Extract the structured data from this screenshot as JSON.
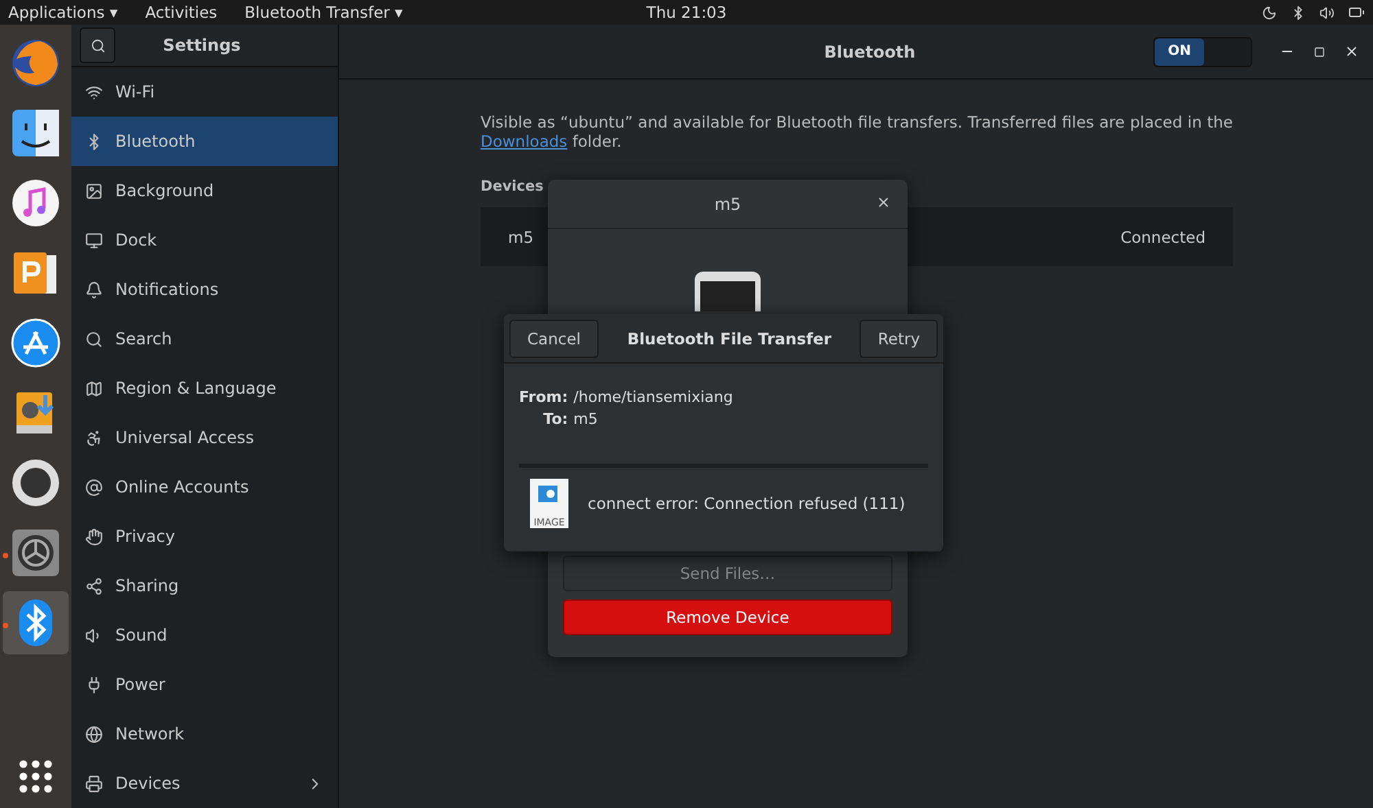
{
  "top_bar": {
    "applications": "Applications ▾",
    "activities": "Activities",
    "app_menu": "Bluetooth Transfer ▾",
    "clock": "Thu 21:03"
  },
  "dock": [
    {
      "running": false,
      "selected": false
    },
    {
      "running": false,
      "selected": false
    },
    {
      "running": false,
      "selected": false
    },
    {
      "running": false,
      "selected": false
    },
    {
      "running": false,
      "selected": false
    },
    {
      "running": false,
      "selected": false
    },
    {
      "running": false,
      "selected": false
    },
    {
      "running": true,
      "selected": false
    },
    {
      "running": true,
      "selected": true
    }
  ],
  "sidebar": {
    "title": "Settings",
    "items": [
      {
        "label": "Wi-Fi",
        "selected": false
      },
      {
        "label": "Bluetooth",
        "selected": true
      },
      {
        "label": "Background",
        "selected": false
      },
      {
        "label": "Dock",
        "selected": false
      },
      {
        "label": "Notifications",
        "selected": false
      },
      {
        "label": "Search",
        "selected": false
      },
      {
        "label": "Region & Language",
        "selected": false
      },
      {
        "label": "Universal Access",
        "selected": false
      },
      {
        "label": "Online Accounts",
        "selected": false
      },
      {
        "label": "Privacy",
        "selected": false
      },
      {
        "label": "Sharing",
        "selected": false
      },
      {
        "label": "Sound",
        "selected": false
      },
      {
        "label": "Power",
        "selected": false
      },
      {
        "label": "Network",
        "selected": false
      },
      {
        "label": "Devices",
        "selected": false
      }
    ]
  },
  "header": {
    "title": "Bluetooth",
    "switch": {
      "label": "ON",
      "on": true
    }
  },
  "content": {
    "intro": "Visible as “ubuntu” and available for Bluetooth file transfers. Transferred files are placed in the",
    "link": "Downloads",
    "intro_end": "folder.",
    "devices_label": "Devices",
    "devices": [
      {
        "name": "m5",
        "status": "Connected"
      }
    ]
  },
  "device_dialog": {
    "title": "m5",
    "send_button": "Send Files…",
    "remove_button": "Remove Device"
  },
  "transfer_dialog": {
    "cancel": "Cancel",
    "title": "Bluetooth File Transfer",
    "retry": "Retry",
    "from_label": "From:",
    "from": "/home/tiansemixiang",
    "to_label": "To:",
    "to": "m5",
    "file_icon_label": "IMAGE",
    "error": "connect error: Connection refused (111)"
  }
}
